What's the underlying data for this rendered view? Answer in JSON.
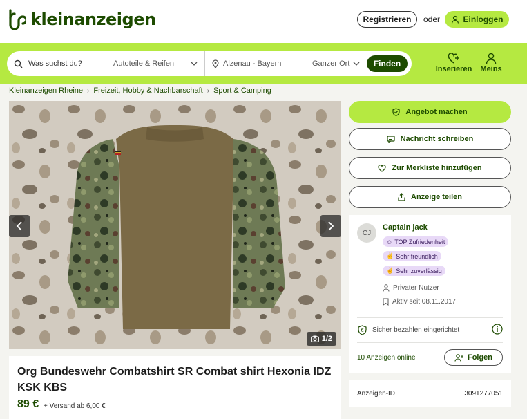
{
  "header": {
    "logo_text": "kleinanzeigen",
    "register_label": "Registrieren",
    "or_label": "oder",
    "login_label": "Einloggen"
  },
  "search": {
    "query_placeholder": "Was suchst du?",
    "category": "Autoteile & Reifen",
    "location": "Alzenau - Bayern",
    "radius": "Ganzer Ort",
    "find_label": "Finden"
  },
  "nav": {
    "insert_label": "Inserieren",
    "me_label": "Meins"
  },
  "breadcrumb": [
    "Kleinanzeigen Rheine",
    "Freizeit, Hobby & Nachbarschaft",
    "Sport & Camping"
  ],
  "gallery": {
    "counter": "1/2"
  },
  "ad": {
    "title": "Org Bundeswehr Combatshirt SR Combat shirt Hexonia IDZ KSK KBS",
    "price": "89 €",
    "shipping": "+ Versand ab 6,00 €"
  },
  "actions": {
    "offer": "Angebot machen",
    "message": "Nachricht schreiben",
    "watchlist": "Zur Merkliste hinzufügen",
    "share": "Anzeige teilen"
  },
  "seller": {
    "initials": "CJ",
    "name": "Captain jack",
    "badges": [
      "TOP Zufriedenheit",
      "Sehr freundlich",
      "Sehr zuverlässig"
    ],
    "type": "Privater Nutzer",
    "active_since": "Aktiv seit 08.11.2017",
    "safe_pay": "Sicher bezahlen eingerichtet",
    "ads_online": "10 Anzeigen online",
    "follow_label": "Folgen"
  },
  "ad_id": {
    "label": "Anzeigen-ID",
    "value": "3091277051"
  },
  "colors": {
    "brand_green": "#b5e941",
    "dark_green": "#1d4b00",
    "badge_purple": "#e8d9f7"
  }
}
